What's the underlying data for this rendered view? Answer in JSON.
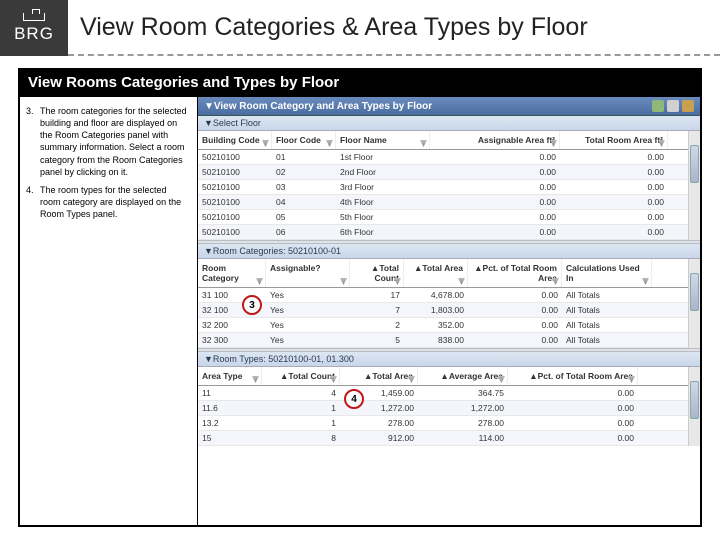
{
  "brand": "BRG",
  "page_title": "View Room Categories & Area Types by Floor",
  "section_title": "View Rooms Categories and Types by Floor",
  "steps": [
    {
      "n": "3.",
      "text": "The room categories for the selected building and floor are displayed on the Room Categories panel with summary information. Select a room category from the Room Categories panel by clicking on it."
    },
    {
      "n": "4.",
      "text": "The room types for the selected room category are displayed on the\nRoom Types panel."
    }
  ],
  "floor_panel": {
    "title": "▼View Room Category and Area Types by Floor",
    "sub": "▼Select Floor",
    "headers": [
      "Building Code",
      "Floor Code",
      "Floor Name",
      "Assignable Area ft²",
      "Total Room Area ft²"
    ],
    "rows": [
      [
        "50210100",
        "01",
        "1st Floor",
        "0.00",
        "0.00"
      ],
      [
        "50210100",
        "02",
        "2nd Floor",
        "0.00",
        "0.00"
      ],
      [
        "50210100",
        "03",
        "3rd Floor",
        "0.00",
        "0.00"
      ],
      [
        "50210100",
        "04",
        "4th Floor",
        "0.00",
        "0.00"
      ],
      [
        "50210100",
        "05",
        "5th Floor",
        "0.00",
        "0.00"
      ],
      [
        "50210100",
        "06",
        "6th Floor",
        "0.00",
        "0.00"
      ]
    ]
  },
  "cat_panel": {
    "title": "▼Room Categories: 50210100-01",
    "headers": [
      "Room Category",
      "Assignable?",
      "▲Total Count",
      "▲Total Area",
      "▲Pct. of Total Room Area",
      "Calculations Used In"
    ],
    "rows": [
      [
        "31 100",
        "Yes",
        "17",
        "4,678.00",
        "0.00",
        "All Totals"
      ],
      [
        "32 100",
        "Yes",
        "7",
        "1,803.00",
        "0.00",
        "All Totals"
      ],
      [
        "32 200",
        "Yes",
        "2",
        "352.00",
        "0.00",
        "All Totals"
      ],
      [
        "32 300",
        "Yes",
        "5",
        "838.00",
        "0.00",
        "All Totals"
      ]
    ]
  },
  "type_panel": {
    "title": "▼Room Types: 50210100-01, 01.300",
    "headers": [
      "Area Type",
      "▲Total Count",
      "▲Total Area",
      "▲Average Area",
      "▲Pct. of Total Room Area"
    ],
    "rows": [
      [
        "11",
        "4",
        "1,459.00",
        "364.75",
        "0.00"
      ],
      [
        "11.6",
        "1",
        "1,272.00",
        "1,272.00",
        "0.00"
      ],
      [
        "13.2",
        "1",
        "278.00",
        "278.00",
        "0.00"
      ],
      [
        "15",
        "8",
        "912.00",
        "114.00",
        "0.00"
      ]
    ]
  },
  "annot": {
    "a": "3",
    "b": "4"
  }
}
